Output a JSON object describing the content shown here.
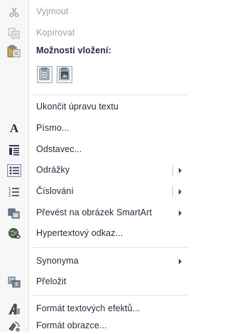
{
  "menu": {
    "cut": {
      "label": "Vyjmout",
      "icon": "scissors-icon"
    },
    "copy": {
      "label": "Kopírovat",
      "icon": "copy-icon"
    },
    "paste_options": {
      "label": "Možnosti vložení:",
      "icon": "paste-icon",
      "buttons": [
        {
          "name": "keep-formatting-paste",
          "icon": "paste-keep-formatting-icon"
        },
        {
          "name": "keep-text-only-paste",
          "icon": "paste-picture-icon"
        }
      ]
    },
    "exit_edit": {
      "label": "Ukončit úpravu textu"
    },
    "font": {
      "label": "Písmo...",
      "icon": "font-a-icon"
    },
    "paragraph": {
      "label": "Odstavec...",
      "icon": "paragraph-icon"
    },
    "bullets": {
      "label": "Odrážky",
      "icon": "bullets-icon"
    },
    "numbering": {
      "label": "Číslování",
      "icon": "numbering-icon"
    },
    "smartart": {
      "label": "Převést na obrázek SmartArt",
      "icon": "smartart-icon"
    },
    "hyperlink": {
      "label": "Hypertextový odkaz...",
      "icon": "hyperlink-icon"
    },
    "synonyms": {
      "label": "Synonyma"
    },
    "translate": {
      "label": "Přeložit",
      "icon": "translate-icon"
    },
    "text_effects": {
      "label": "Formát textových efektů...",
      "icon": "text-effects-icon"
    },
    "format_picture": {
      "label": "Formát obrazce...",
      "icon": "format-shape-icon"
    }
  }
}
